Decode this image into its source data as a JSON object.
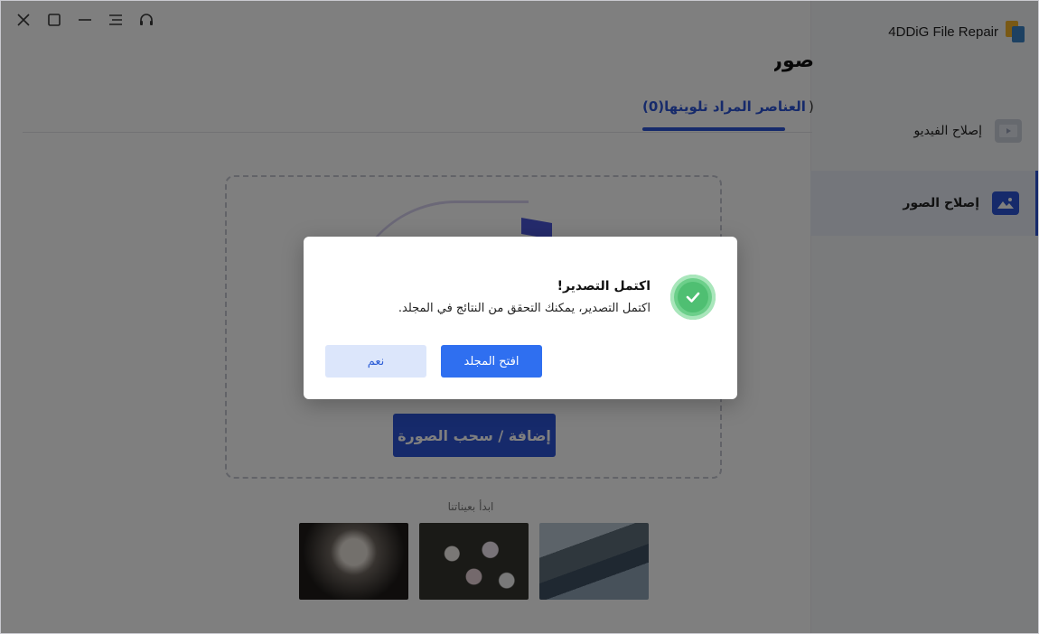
{
  "app": {
    "name": "4DDiG File Repair",
    "accent": "#2c55d6",
    "window_controls": [
      "close-icon",
      "maximize-icon",
      "minimize-icon",
      "menu-icon",
      "support-headset-icon"
    ]
  },
  "sidebar": {
    "items": [
      {
        "label": "إصلاح الفيديو",
        "icon": "video-icon",
        "active": false
      },
      {
        "label": "إصلاح الصور",
        "icon": "image-icon",
        "active": true
      }
    ]
  },
  "main": {
    "title": "صور",
    "tabs": [
      {
        "label": "(0)العناصر المراد تلوينها",
        "active": true
      },
      {
        "label": ")",
        "active": false
      }
    ],
    "dropzone": {
      "add_button_label": "إضافة / سحب الصورة"
    },
    "samples": {
      "label": "ابدأ بعيناتنا",
      "items": [
        {
          "name": "portrait"
        },
        {
          "name": "flowers"
        },
        {
          "name": "mountain-lake"
        }
      ]
    }
  },
  "dialog": {
    "title": "اكتمل التصدير!",
    "message": "اكتمل التصدير، يمكنك التحقق من النتائج في المجلد.",
    "buttons": {
      "open_folder": "افتح المجلد",
      "yes": "نعم"
    },
    "status_color": "#4fbf72"
  }
}
